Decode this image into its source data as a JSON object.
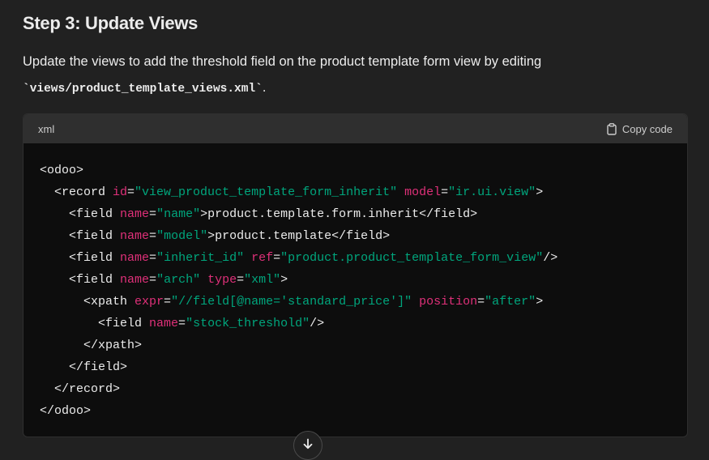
{
  "section": {
    "heading": "Step 3: Update Views",
    "paragraph_text": "Update the views to add the threshold field on the product template form view by editing",
    "inline_code": "`views/product_template_views.xml`",
    "paragraph_end": "."
  },
  "code_block": {
    "language": "xml",
    "copy_label": "Copy code",
    "lines": [
      [
        {
          "t": "tag",
          "v": "<odoo>"
        }
      ],
      [
        {
          "t": "tag",
          "v": "  <record "
        },
        {
          "t": "attr",
          "v": "id"
        },
        {
          "t": "tag",
          "v": "="
        },
        {
          "t": "str",
          "v": "\"view_product_template_form_inherit\""
        },
        {
          "t": "tag",
          "v": " "
        },
        {
          "t": "attr",
          "v": "model"
        },
        {
          "t": "tag",
          "v": "="
        },
        {
          "t": "str",
          "v": "\"ir.ui.view\""
        },
        {
          "t": "tag",
          "v": ">"
        }
      ],
      [
        {
          "t": "tag",
          "v": "    <field "
        },
        {
          "t": "attr",
          "v": "name"
        },
        {
          "t": "tag",
          "v": "="
        },
        {
          "t": "str",
          "v": "\"name\""
        },
        {
          "t": "tag",
          "v": ">product.template.form.inherit</field>"
        }
      ],
      [
        {
          "t": "tag",
          "v": "    <field "
        },
        {
          "t": "attr",
          "v": "name"
        },
        {
          "t": "tag",
          "v": "="
        },
        {
          "t": "str",
          "v": "\"model\""
        },
        {
          "t": "tag",
          "v": ">product.template</field>"
        }
      ],
      [
        {
          "t": "tag",
          "v": "    <field "
        },
        {
          "t": "attr",
          "v": "name"
        },
        {
          "t": "tag",
          "v": "="
        },
        {
          "t": "str",
          "v": "\"inherit_id\""
        },
        {
          "t": "tag",
          "v": " "
        },
        {
          "t": "attr",
          "v": "ref"
        },
        {
          "t": "tag",
          "v": "="
        },
        {
          "t": "str",
          "v": "\"product.product_template_form_view\""
        },
        {
          "t": "tag",
          "v": "/>"
        }
      ],
      [
        {
          "t": "tag",
          "v": "    <field "
        },
        {
          "t": "attr",
          "v": "name"
        },
        {
          "t": "tag",
          "v": "="
        },
        {
          "t": "str",
          "v": "\"arch\""
        },
        {
          "t": "tag",
          "v": " "
        },
        {
          "t": "attr",
          "v": "type"
        },
        {
          "t": "tag",
          "v": "="
        },
        {
          "t": "str",
          "v": "\"xml\""
        },
        {
          "t": "tag",
          "v": ">"
        }
      ],
      [
        {
          "t": "tag",
          "v": "      <xpath "
        },
        {
          "t": "attr",
          "v": "expr"
        },
        {
          "t": "tag",
          "v": "="
        },
        {
          "t": "str",
          "v": "\"//field[@name='standard_price']\""
        },
        {
          "t": "tag",
          "v": " "
        },
        {
          "t": "attr",
          "v": "position"
        },
        {
          "t": "tag",
          "v": "="
        },
        {
          "t": "str",
          "v": "\"after\""
        },
        {
          "t": "tag",
          "v": ">"
        }
      ],
      [
        {
          "t": "tag",
          "v": "        <field "
        },
        {
          "t": "attr",
          "v": "name"
        },
        {
          "t": "tag",
          "v": "="
        },
        {
          "t": "str",
          "v": "\"stock_threshold\""
        },
        {
          "t": "tag",
          "v": "/>"
        }
      ],
      [
        {
          "t": "tag",
          "v": "      </xpath>"
        }
      ],
      [
        {
          "t": "tag",
          "v": "    </field>"
        }
      ],
      [
        {
          "t": "tag",
          "v": "  </record>"
        }
      ],
      [
        {
          "t": "tag",
          "v": "</odoo>"
        }
      ]
    ]
  },
  "colors": {
    "background": "#212121",
    "code_background": "#0d0d0d",
    "code_header": "#2f2f2f",
    "attribute": "#df3079",
    "string": "#00a67d",
    "text": "#ececec"
  },
  "icons": {
    "copy": "clipboard-icon",
    "scroll_down": "arrow-down-icon"
  }
}
